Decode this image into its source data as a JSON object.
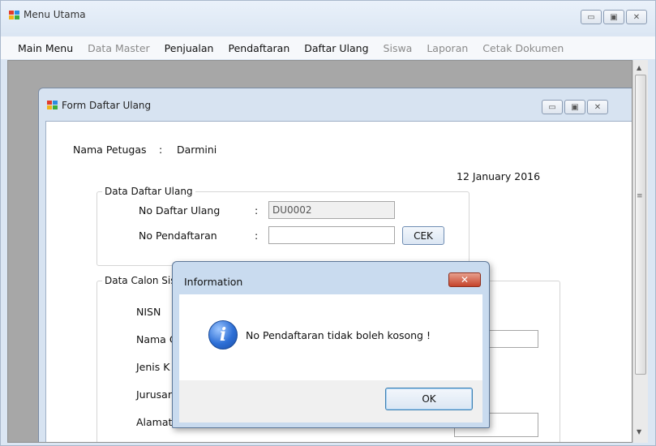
{
  "main_window": {
    "title": "Menu Utama",
    "menu": [
      {
        "label": "Main Menu",
        "enabled": true
      },
      {
        "label": "Data Master",
        "enabled": false
      },
      {
        "label": "Penjualan",
        "enabled": true
      },
      {
        "label": "Pendaftaran",
        "enabled": true
      },
      {
        "label": "Daftar Ulang",
        "enabled": true
      },
      {
        "label": "Siswa",
        "enabled": false
      },
      {
        "label": "Laporan",
        "enabled": false
      },
      {
        "label": "Cetak Dokumen",
        "enabled": false
      }
    ]
  },
  "form": {
    "title": "Form Daftar Ulang",
    "petugas_label": "Nama Petugas",
    "petugas_sep": ":",
    "petugas_value": "Darmini",
    "date": "12 January 2016",
    "group_daftar_ulang": {
      "legend": "Data Daftar Ulang",
      "no_daftar_ulang_label": "No Daftar Ulang",
      "no_daftar_ulang_sep": ":",
      "no_daftar_ulang_value": "DU0002",
      "no_pendaftaran_label": "No Pendaftaran",
      "no_pendaftaran_sep": ":",
      "no_pendaftaran_value": "",
      "cek_button": "CEK"
    },
    "group_calon_siswa": {
      "legend": "Data Calon Sis",
      "fields": [
        "NISN",
        "Nama C",
        "Jenis K",
        "Jurusar",
        "Alamat"
      ]
    }
  },
  "dialog": {
    "title": "Information",
    "close_glyph": "✕",
    "icon_glyph": "i",
    "message": "No Pendaftaran tidak boleh kosong !",
    "ok_button": "OK"
  },
  "icons": {
    "window_controls": [
      "minimize-icon",
      "maximize-icon",
      "close-icon"
    ],
    "glyphs": {
      "minimize": "▭",
      "maximize": "▣",
      "close": "✕",
      "scroll_up": "▲",
      "scroll_down": "▼",
      "grip": "≡"
    }
  }
}
